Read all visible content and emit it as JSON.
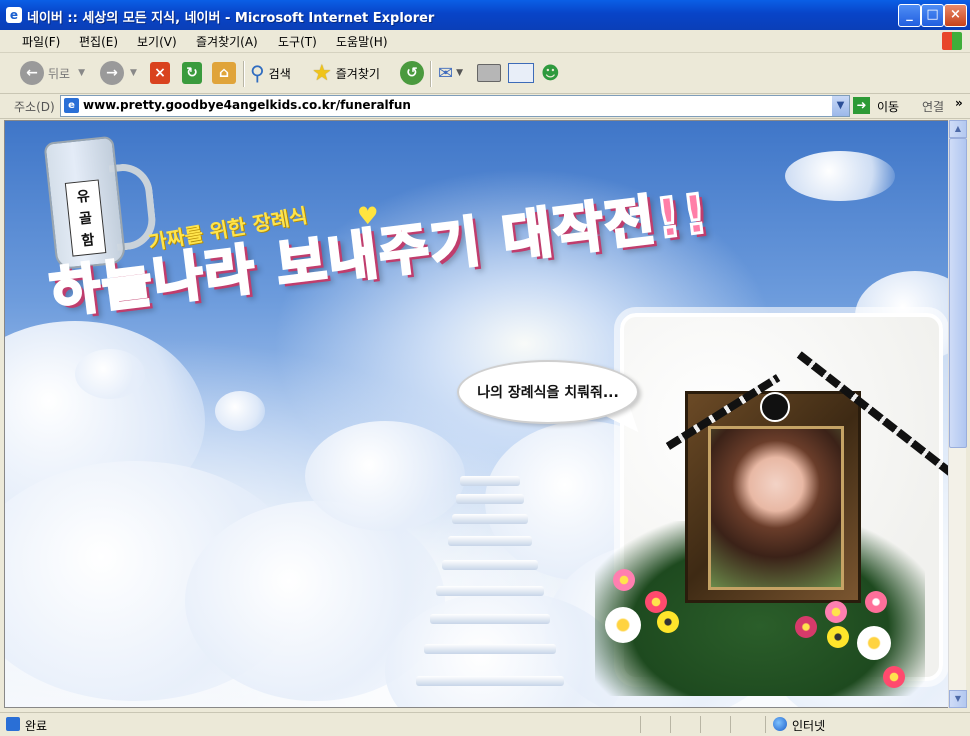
{
  "window": {
    "title": "네이버 :: 세상의 모든 지식, 네이버 - Microsoft Internet Explorer",
    "buttons": [
      "_",
      "□",
      "×"
    ]
  },
  "menu": [
    "파일(F)",
    "편집(E)",
    "보기(V)",
    "즐겨찾기(A)",
    "도구(T)",
    "도움말(H)"
  ],
  "toolbar": {
    "back_label": "뒤로",
    "search_label": "검색",
    "favorites_label": "즐겨찾기"
  },
  "address": {
    "label": "주소(D)",
    "url": "www.pretty.goodbye4angelkids.co.kr/funeralfun",
    "go_label": "이동",
    "links_label": "연결"
  },
  "page": {
    "jar_label": "유골함",
    "subtitle": "가짜를 위한 장례식",
    "title": "하늘나라 보내주기 대작전!!",
    "speech": "나의 장례식을 치뤄줘..."
  },
  "status": {
    "text": "완료",
    "zone": "인터넷"
  }
}
